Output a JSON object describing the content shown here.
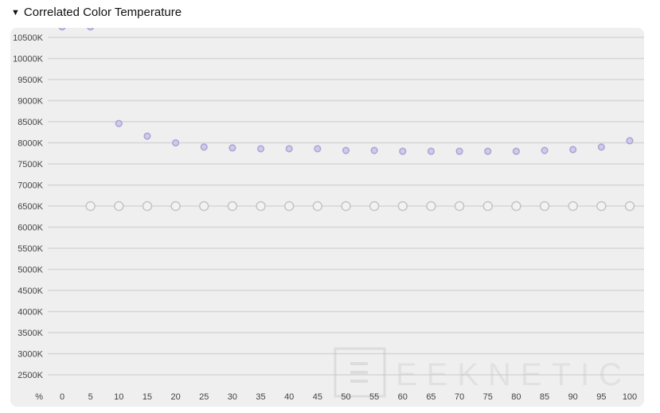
{
  "section": {
    "title": "Correlated Color Temperature",
    "toggle_icon": "triangle-down-icon"
  },
  "watermark": "GEEKNETIC",
  "chart_data": {
    "type": "scatter",
    "title": "Correlated Color Temperature",
    "xlabel": "%",
    "ylabel": "",
    "x": [
      0,
      5,
      10,
      15,
      20,
      25,
      30,
      35,
      40,
      45,
      50,
      55,
      60,
      65,
      70,
      75,
      80,
      85,
      90,
      95,
      100
    ],
    "x_tick_labels": [
      "0",
      "5",
      "10",
      "15",
      "20",
      "25",
      "30",
      "35",
      "40",
      "45",
      "50",
      "55",
      "60",
      "65",
      "70",
      "75",
      "80",
      "85",
      "90",
      "95",
      "100"
    ],
    "y_tick_labels": [
      "10500K",
      "10000K",
      "9500K",
      "9000K",
      "8500K",
      "8000K",
      "7500K",
      "7000K",
      "6500K",
      "6000K",
      "5500K",
      "5000K",
      "4500K",
      "4000K",
      "3500K",
      "3000K",
      "2500K"
    ],
    "y_ticks": [
      10500,
      10000,
      9500,
      9000,
      8500,
      8000,
      7500,
      7000,
      6500,
      6000,
      5500,
      5000,
      4500,
      4000,
      3500,
      3000,
      2500
    ],
    "ylim": [
      2500,
      10500
    ],
    "xlim": [
      0,
      100
    ],
    "grid": true,
    "series": [
      {
        "color": "#a9a4d6",
        "fill": "#cfcbe8",
        "x": [
          0,
          5,
          10,
          15,
          20,
          25,
          30,
          35,
          40,
          45,
          50,
          55,
          60,
          65,
          70,
          75,
          80,
          85,
          90,
          95,
          100
        ],
        "values": [
          10750,
          10750,
          8460,
          8160,
          8000,
          7900,
          7880,
          7860,
          7860,
          7860,
          7820,
          7820,
          7800,
          7800,
          7800,
          7800,
          7800,
          7820,
          7840,
          7900,
          8050
        ]
      },
      {
        "color": "#c4c4c4",
        "fill": "#f2f2f2",
        "x": [
          5,
          10,
          15,
          20,
          25,
          30,
          35,
          40,
          45,
          50,
          55,
          60,
          65,
          70,
          75,
          80,
          85,
          90,
          95,
          100
        ],
        "values": [
          6500,
          6500,
          6500,
          6500,
          6500,
          6500,
          6500,
          6500,
          6500,
          6500,
          6500,
          6500,
          6500,
          6500,
          6500,
          6500,
          6500,
          6500,
          6500,
          6500
        ]
      }
    ]
  }
}
